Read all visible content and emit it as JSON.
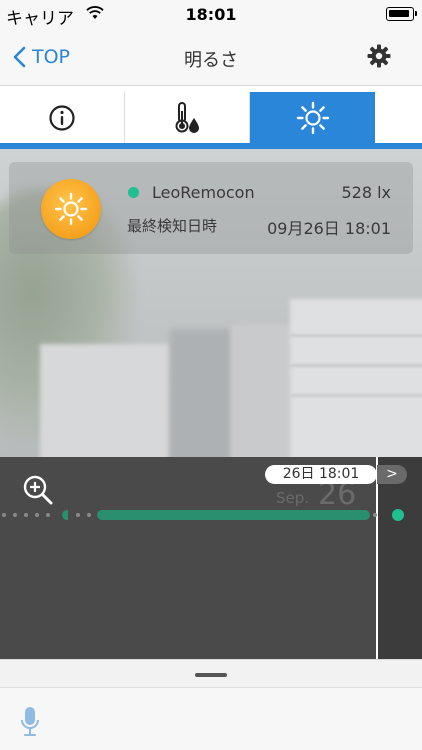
{
  "status_bar": {
    "carrier": "キャリア",
    "time": "18:01"
  },
  "nav": {
    "back_label": "TOP",
    "title": "明るさ"
  },
  "tabs": [
    {
      "name": "info",
      "icon": "info-icon",
      "active": false
    },
    {
      "name": "temperature",
      "icon": "thermometer-drop-icon",
      "active": false
    },
    {
      "name": "brightness",
      "icon": "sun-icon",
      "active": true
    }
  ],
  "card": {
    "device_name": "LeoRemocon",
    "lux_value": "528 lx",
    "last_detected_label": "最終検知日時",
    "last_detected_value": "09月26日 18:01",
    "status_color": "#1fbf8f"
  },
  "timeline": {
    "current_time": "26日 18:01",
    "next_label": ">",
    "ghost_month": "Sep.",
    "ghost_day": "26",
    "bar_color": "#2a8f6e"
  },
  "colors": {
    "accent": "#2a86d8",
    "sun": "#f6a21e"
  }
}
